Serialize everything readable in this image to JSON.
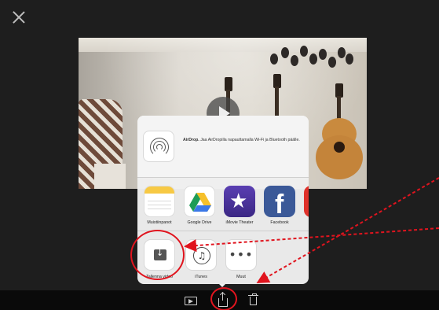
{
  "close_button": {
    "icon": "close-icon"
  },
  "video": {
    "play_icon": "play-icon"
  },
  "share_sheet": {
    "airdrop": {
      "icon": "airdrop-icon",
      "title": "AirDrop.",
      "text": "Jaa AirDropilla napauttamalla Wi-Fi ja Bluetooth päälle."
    },
    "apps": [
      {
        "label": "Muistiinpanot",
        "icon": "notes-icon"
      },
      {
        "label": "Google Drive",
        "icon": "google-drive-icon"
      },
      {
        "label": "iMovie Theater",
        "icon": "imovie-theater-icon"
      },
      {
        "label": "Facebook",
        "icon": "facebook-icon"
      }
    ],
    "actions": [
      {
        "label": "Tallenna video",
        "icon": "save-video-icon"
      },
      {
        "label": "iTunes",
        "icon": "itunes-icon"
      },
      {
        "label": "Muut",
        "icon": "more-icon"
      }
    ]
  },
  "toolbar": {
    "items": [
      {
        "icon": "play-icon"
      },
      {
        "icon": "share-icon"
      },
      {
        "icon": "trash-icon"
      }
    ]
  },
  "colors": {
    "annotation": "#e0141e",
    "background": "#1e1e1e",
    "toolbar": "#0a0a0a"
  }
}
